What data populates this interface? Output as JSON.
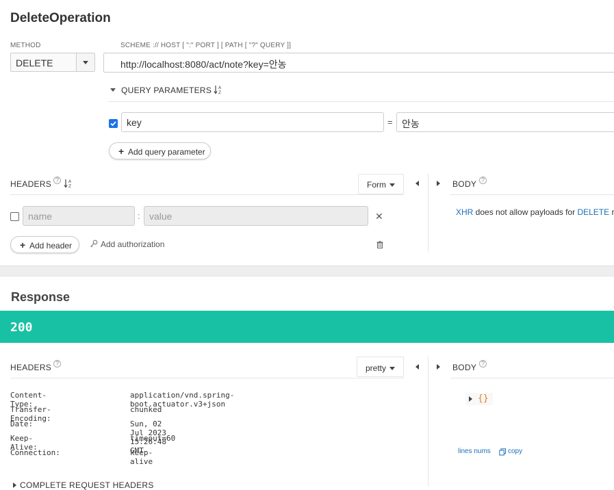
{
  "request": {
    "title": "DeleteOperation",
    "method_label": "METHOD",
    "method_value": "DELETE",
    "url_label": "SCHEME :// HOST [ \":\" PORT ] [ PATH [ \"?\" QUERY ]]",
    "url_value": "http://localhost:8080/act/note?key=안농",
    "query_section_label": "QUERY PARAMETERS",
    "query_params": [
      {
        "checked": true,
        "key": "key",
        "equals": "=",
        "value": "안농"
      }
    ],
    "add_query_label": "Add query parameter",
    "headers_label": "HEADERS",
    "headers_mode": "Form",
    "header_row": {
      "name_placeholder": "name",
      "separator": ":",
      "value_placeholder": "value"
    },
    "add_header_label": "Add header",
    "add_auth_label": "Add authorization",
    "body_label": "BODY",
    "body_message": {
      "xhr": "XHR",
      "middle": " does not allow payloads for ",
      "method": "DELETE",
      "tail": " r"
    }
  },
  "response": {
    "title": "Response",
    "status_code": "200",
    "status_color": "#18c1a3",
    "headers_label": "HEADERS",
    "headers_mode": "pretty",
    "body_label": "BODY",
    "headers": [
      {
        "name": "Content-Type:",
        "value": "application/vnd.spring-boot.actuator.v3+json"
      },
      {
        "name": "Transfer-Encoding:",
        "value": "chunked"
      },
      {
        "name": "Date:",
        "value": "Sun, 02 Jul 2023 15:26:48 GMT"
      },
      {
        "name": "Keep-Alive:",
        "value": "timeout=60"
      },
      {
        "name": "Connection:",
        "value": "keep-alive"
      }
    ],
    "body_preview": "{}",
    "lines_nums_label": "lines nums",
    "copy_label": "copy",
    "complete_request_headers_label": "COMPLETE REQUEST HEADERS"
  },
  "icons": {
    "sort": "sort-icon",
    "help": "question-mark-icon",
    "close": "close-icon",
    "trash": "trash-icon",
    "key": "key-icon",
    "copy": "copy-icon"
  }
}
